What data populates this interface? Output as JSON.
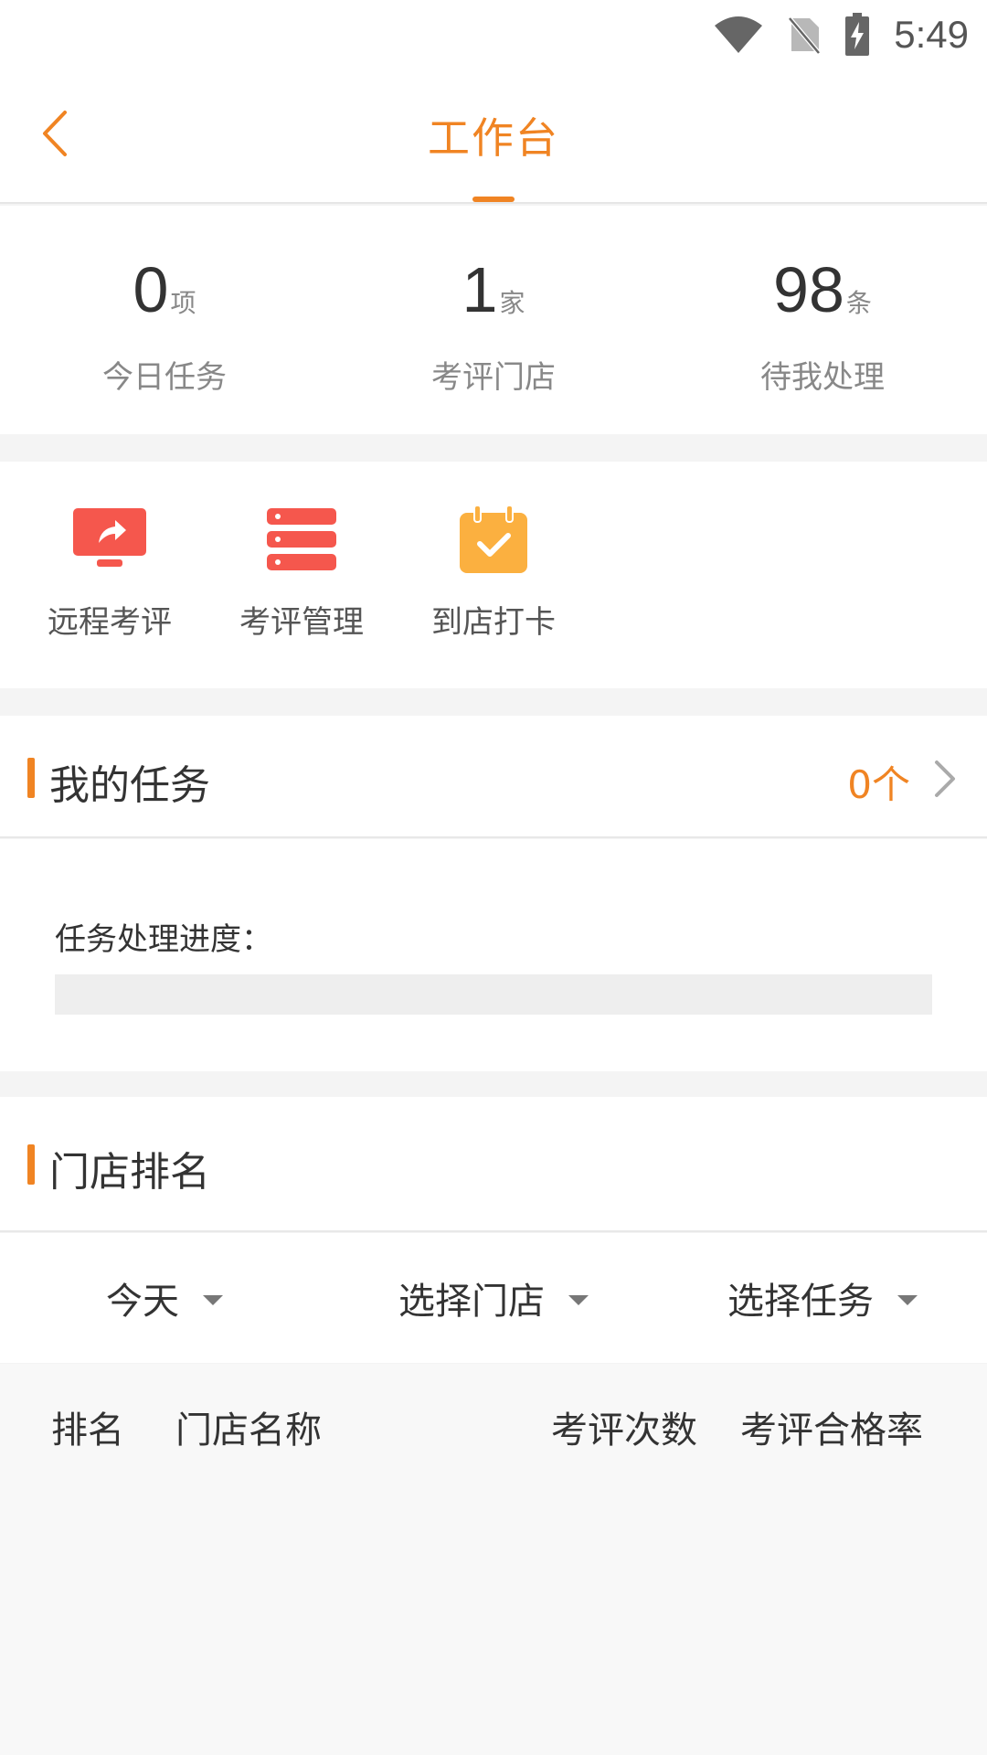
{
  "status_bar": {
    "time": "5:49",
    "icons": [
      "wifi-icon",
      "no-sim-icon",
      "battery-charging-icon"
    ]
  },
  "header": {
    "title": "工作台",
    "back_icon": "chevron-left-icon"
  },
  "stats": [
    {
      "value": "0",
      "unit": "项",
      "label": "今日任务"
    },
    {
      "value": "1",
      "unit": "家",
      "label": "考评门店"
    },
    {
      "value": "98",
      "unit": "条",
      "label": "待我处理"
    }
  ],
  "actions": [
    {
      "label": "远程考评",
      "icon": "remote-monitor-icon",
      "color": "#f5574d"
    },
    {
      "label": "考评管理",
      "icon": "server-list-icon",
      "color": "#f5574d"
    },
    {
      "label": "到店打卡",
      "icon": "calendar-check-icon",
      "color": "#fbb040"
    }
  ],
  "my_tasks": {
    "title": "我的任务",
    "count": "0个",
    "progress_label": "任务处理进度：",
    "progress_percent": 0
  },
  "ranking": {
    "title": "门店排名",
    "filters": [
      {
        "label": "今天"
      },
      {
        "label": "选择门店"
      },
      {
        "label": "选择任务"
      }
    ],
    "columns": [
      "排名",
      "门店名称",
      "考评次数",
      "考评合格率"
    ],
    "rows": []
  },
  "colors": {
    "accent": "#f08423",
    "action_red": "#f5574d",
    "action_yellow": "#fbb040"
  }
}
